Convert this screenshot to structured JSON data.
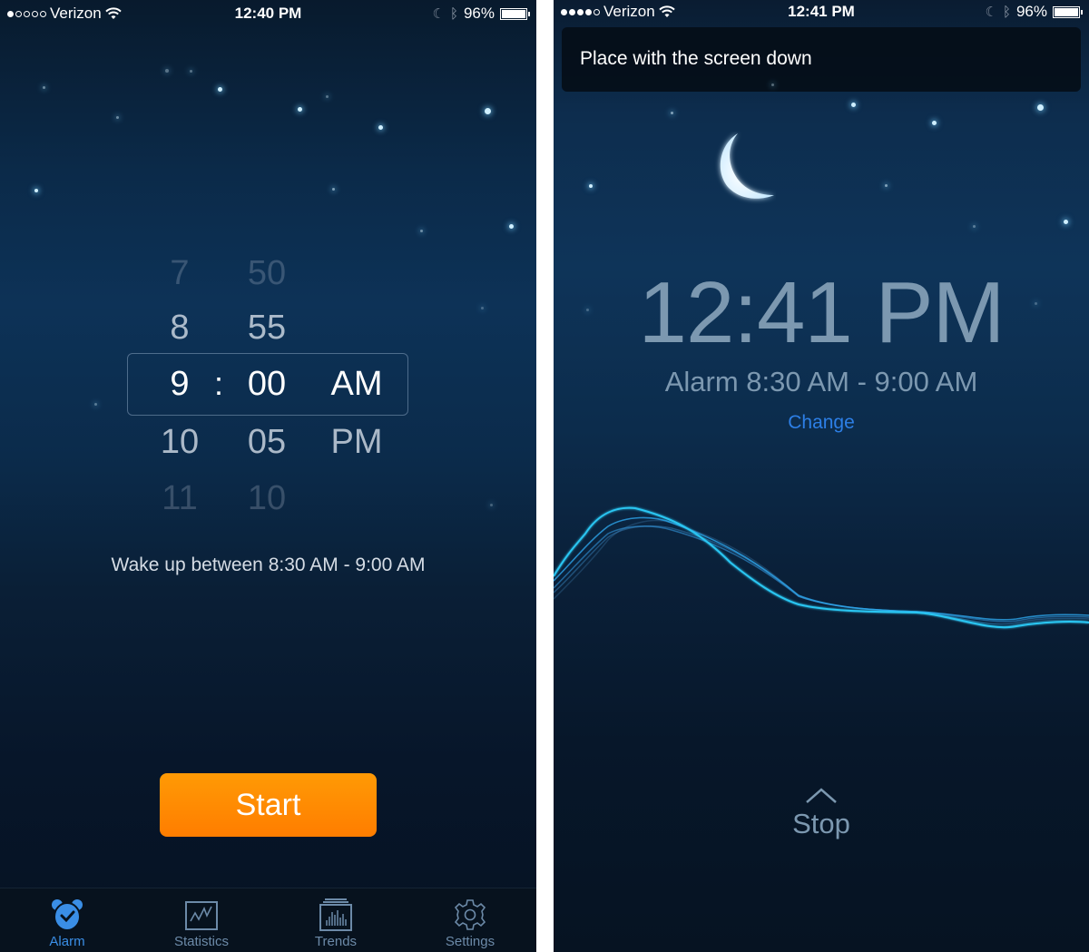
{
  "left_screen": {
    "status_bar": {
      "signal_bars": 1,
      "signal_total": 5,
      "carrier": "Verizon",
      "time": "12:40 PM",
      "battery": "96%",
      "battery_level": 0.96
    },
    "picker": {
      "hours": [
        "7",
        "8",
        "9",
        "10",
        "11"
      ],
      "minutes": [
        "50",
        "55",
        "00",
        "05",
        "10"
      ],
      "periods": [
        "AM",
        "PM"
      ],
      "separator": ":",
      "selected": {
        "hour": "9",
        "minute": "00",
        "period": "AM"
      }
    },
    "wake_text": "Wake up between 8:30 AM - 9:00 AM",
    "start_label": "Start",
    "tabs": [
      {
        "label": "Alarm",
        "icon": "alarm-clock-icon",
        "active": true
      },
      {
        "label": "Statistics",
        "icon": "statistics-chart-icon",
        "active": false
      },
      {
        "label": "Trends",
        "icon": "trends-bars-icon",
        "active": false
      },
      {
        "label": "Settings",
        "icon": "gear-icon",
        "active": false
      }
    ],
    "colors": {
      "accent": "#3a8ee6",
      "start_button": "#ff8a00",
      "tab_inactive": "#6c8aa8"
    }
  },
  "right_screen": {
    "status_bar": {
      "signal_bars": 4,
      "signal_total": 5,
      "carrier": "Verizon",
      "time": "12:41 PM",
      "battery": "96%",
      "battery_level": 0.96
    },
    "toast": "Place with the screen down",
    "clock": "12:41 PM",
    "alarm_range": "Alarm 8:30 AM - 9:00 AM",
    "change_label": "Change",
    "stop_label": "Stop",
    "colors": {
      "clock_text": "#7c98b0",
      "link": "#2d7fe6",
      "wave": "#29c6f2"
    }
  }
}
